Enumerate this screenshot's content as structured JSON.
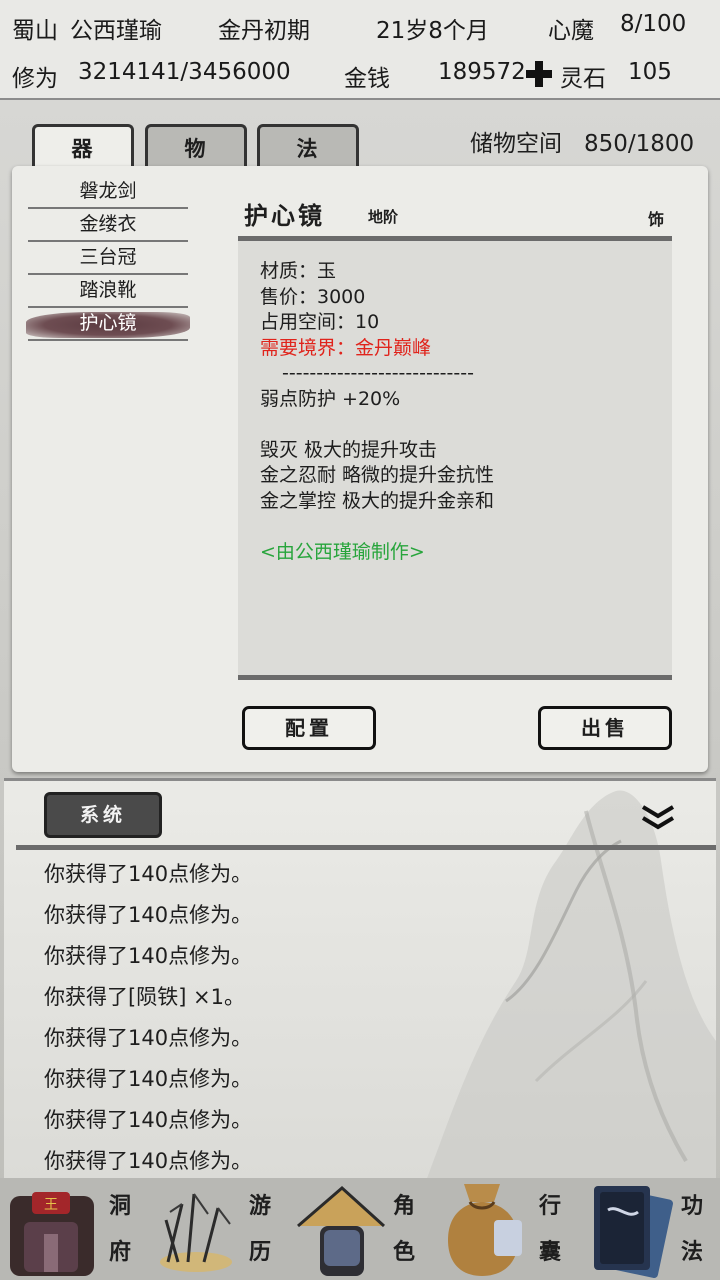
{
  "status": {
    "location": "蜀山",
    "name": "公西瑾瑜",
    "realm": "金丹初期",
    "age": "21岁8个月",
    "demon_label": "心魔",
    "demon_value": "8/100",
    "cultivation_label": "修为",
    "cultivation_value": "3214141/3456000",
    "money_label": "金钱",
    "money_value": "189572",
    "stone_label": "灵石",
    "stone_value": "105"
  },
  "tabs": [
    {
      "label": "器",
      "active": true
    },
    {
      "label": "物",
      "active": false
    },
    {
      "label": "法",
      "active": false
    }
  ],
  "storage": {
    "label": "储物空间",
    "value": "850/1800"
  },
  "items": [
    "磐龙剑",
    "金缕衣",
    "三台冠",
    "踏浪靴",
    "护心镜"
  ],
  "selected_index": 4,
  "detail": {
    "name": "护心镜",
    "grade": "地阶",
    "slot": "饰",
    "material": "材质：玉",
    "price": "售价：3000",
    "space": "占用空间：10",
    "requirement": "需要境界：金丹巅峰",
    "divider": "----------------------------",
    "stat": "弱点防护 +20%",
    "affixes": [
      "毁灭 极大的提升攻击",
      "金之忍耐 略微的提升金抗性",
      "金之掌控 极大的提升金亲和"
    ],
    "maker": "<由公西瑾瑜制作>"
  },
  "buttons": {
    "equip": "配置",
    "sell": "出售"
  },
  "log": {
    "tab_label": "系统",
    "lines": [
      "你获得了140点修为。",
      "你获得了140点修为。",
      "你获得了140点修为。",
      "你获得了[陨铁] ×1。",
      "你获得了140点修为。",
      "你获得了140点修为。",
      "你获得了140点修为。",
      "你获得了140点修为。"
    ]
  },
  "nav": [
    {
      "label1": "洞",
      "label2": "府"
    },
    {
      "label1": "游",
      "label2": "历"
    },
    {
      "label1": "角",
      "label2": "色"
    },
    {
      "label1": "行",
      "label2": "囊"
    },
    {
      "label1": "功",
      "label2": "法"
    }
  ],
  "colors": {
    "requirement": "#e0241c",
    "maker": "#28a53c",
    "selected_item_bg": "#5b3b41"
  }
}
